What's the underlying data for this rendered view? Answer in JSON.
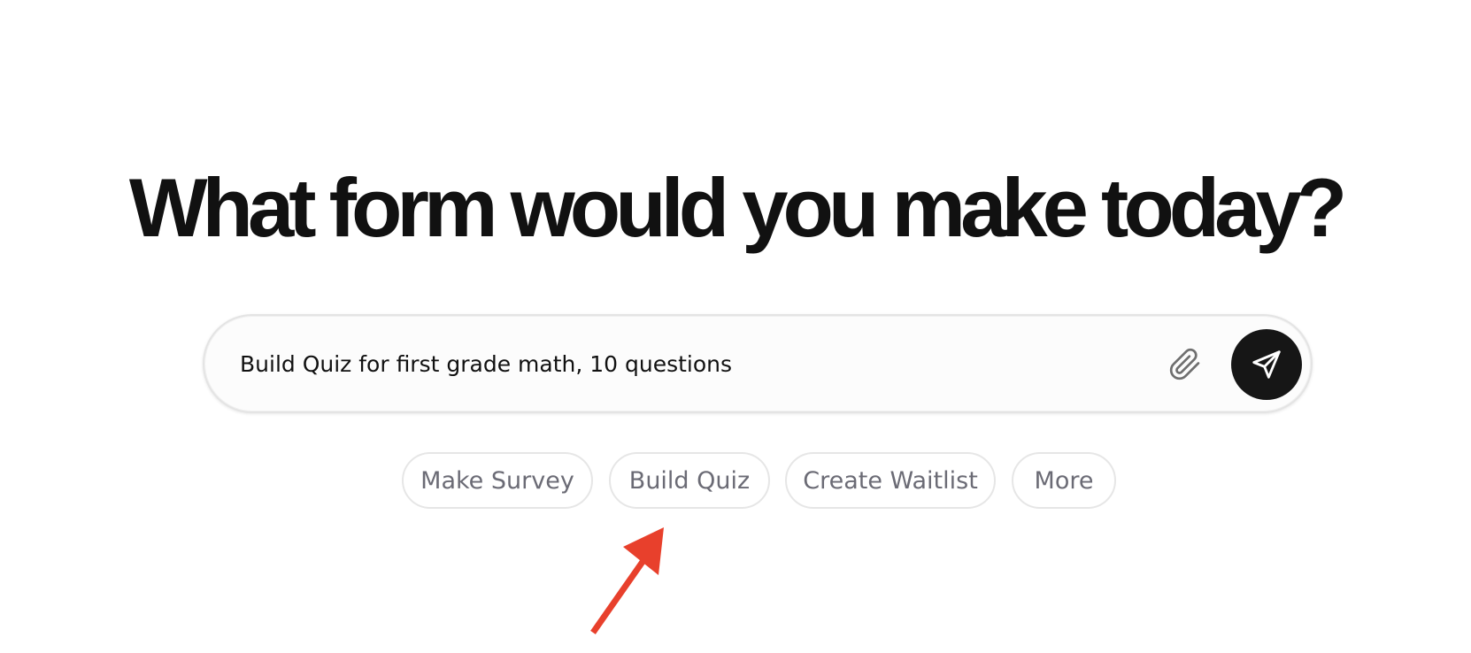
{
  "headline": "What form would you make today?",
  "prompt": {
    "value": "Build Quiz for first grade math, 10 questions",
    "placeholder": "",
    "attach_icon": "paperclip-icon",
    "send_icon": "send-icon"
  },
  "suggestions": [
    {
      "label": "Make Survey"
    },
    {
      "label": "Build Quiz"
    },
    {
      "label": "Create Waitlist"
    },
    {
      "label": "More"
    }
  ],
  "colors": {
    "send_button": "#161616",
    "chip_text": "#6b6b75",
    "annotation_arrow": "#e8402c"
  }
}
